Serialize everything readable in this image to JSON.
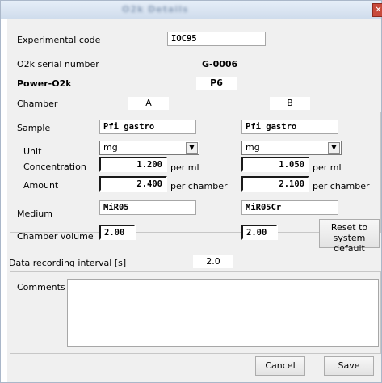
{
  "window": {
    "title": "O2k Details"
  },
  "experimental_code": {
    "label": "Experimental code",
    "value": "IOC95"
  },
  "serial": {
    "label": "O2k serial number",
    "value": "G-0006"
  },
  "power": {
    "label": "Power-O2k",
    "value": "P6"
  },
  "chamber": {
    "label": "Chamber",
    "a": "A",
    "b": "B"
  },
  "sample": {
    "label": "Sample",
    "a": "Pfi gastro",
    "b": "Pfi gastro"
  },
  "unit": {
    "label": "Unit",
    "a": "mg",
    "b": "mg"
  },
  "concentration": {
    "label": "Concentration",
    "a": "1.200",
    "b": "1.050",
    "suffix": "per ml"
  },
  "amount": {
    "label": "Amount",
    "a": "2.400",
    "b": "2.100",
    "suffix": "per chamber"
  },
  "medium": {
    "label": "Medium",
    "a": "MiR05",
    "b": "MiR05Cr"
  },
  "chamber_volume": {
    "label": "Chamber volume",
    "a": "2.00",
    "b": "2.00"
  },
  "reset_button": {
    "line1": "Reset to",
    "line2": "system default"
  },
  "interval": {
    "label": "Data recording interval [s]",
    "value": "2.0"
  },
  "comments": {
    "label": "Comments",
    "value": ""
  },
  "buttons": {
    "cancel": "Cancel",
    "save": "Save"
  }
}
